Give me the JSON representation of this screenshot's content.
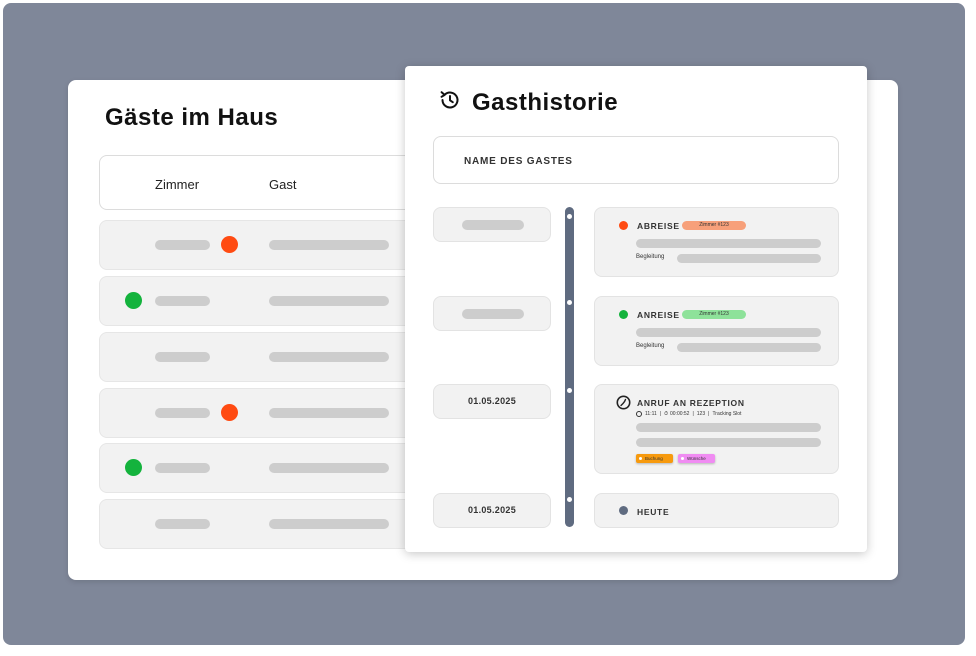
{
  "guests": {
    "title": "Gäste im Haus",
    "columns": {
      "room": "Zimmer",
      "guest": "Gast"
    },
    "rows": [
      {
        "status": "departure"
      },
      {
        "status": "arrival"
      },
      {
        "status": "none"
      },
      {
        "status": "departure"
      },
      {
        "status": "arrival"
      },
      {
        "status": "none"
      }
    ]
  },
  "history": {
    "title": "Gasthistorie",
    "icon": "history-icon",
    "name_label": "NAME DES GASTES",
    "dates": [
      "",
      "",
      "01.05.2025",
      "01.05.2025"
    ],
    "events": [
      {
        "title": "ABREISE",
        "badge": "Zimmer #123",
        "companion_label": "Begleitung"
      },
      {
        "title": "ANREISE",
        "badge": "Zimmer #123",
        "companion_label": "Begleitung"
      },
      {
        "title": "ANRUF AN REZEPTION",
        "meta": {
          "time": "11:11",
          "duration": "00:00:52",
          "count": "123",
          "tracking": "Tracking Slot"
        },
        "tags": [
          "Buchung",
          "Wünsche"
        ]
      },
      {
        "title": "HEUTE"
      }
    ]
  },
  "colors": {
    "backdrop": "#7f8799",
    "departure": "#ff4b12",
    "arrival": "#14b33d",
    "timeline": "#5f6b80",
    "badge_departure": "#f7a07a",
    "badge_arrival": "#8ee29a",
    "tag_buchung": "#f79a0e",
    "tag_wuensche": "#f08cf2"
  }
}
